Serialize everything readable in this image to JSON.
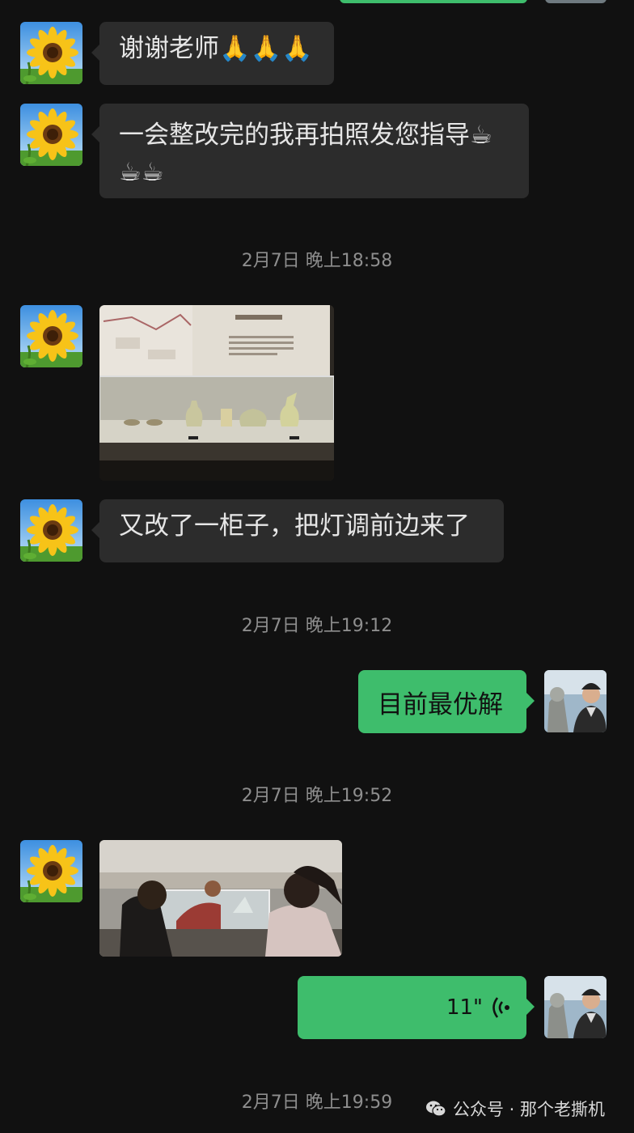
{
  "messages": {
    "m1": {
      "text": "谢谢老师🙏🙏🙏"
    },
    "m2": {
      "text": "一会整改完的我再拍照发您指导☕☕☕"
    },
    "ts1": "2月7日 晚上18:58",
    "m3": {
      "image": "museum-display-case-photo"
    },
    "m4": {
      "text": "又改了一柜子，把灯调前边来了"
    },
    "ts2": "2月7日 晚上19:12",
    "m5": {
      "text": "目前最优解"
    },
    "ts3": "2月7日 晚上19:52",
    "m6": {
      "image": "visitors-at-display-case-photo"
    },
    "m7": {
      "voice_duration": "11\"",
      "icon": "voice-wave-icon"
    },
    "ts4": "2月7日 晚上19:59"
  },
  "watermark": {
    "text": "公众号 · 那个老撕机",
    "icon": "wechat-icon"
  },
  "colors": {
    "background": "#111111",
    "incoming": "#2c2c2c",
    "outgoing": "#3ebd6c",
    "timestamp": "#8e8e8e"
  }
}
